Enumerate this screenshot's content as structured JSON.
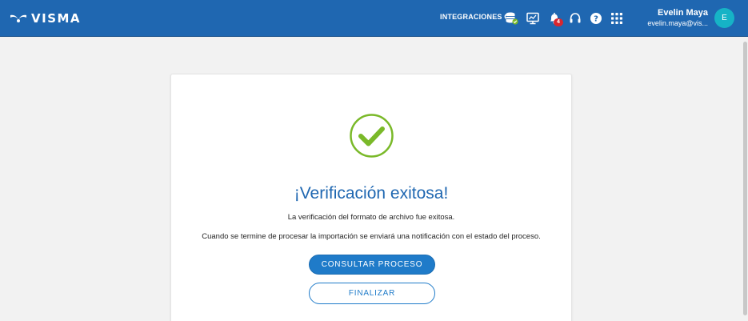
{
  "header": {
    "brand": "VISMA",
    "integrations_label": "INTEGRACIONES CS",
    "icons": [
      "database-check-icon",
      "monitor-chart-icon",
      "bell-icon",
      "headset-icon",
      "help-icon",
      "apps-grid-icon"
    ],
    "notification_count": "4",
    "user": {
      "name": "Evelin Maya",
      "email": "evelin.maya@vis...",
      "avatar_initial": "E"
    }
  },
  "main": {
    "status_icon": "success-check-icon",
    "title": "¡Verificación exitosa!",
    "message": "La verificación del formato de archivo fue exitosa.",
    "note": "Cuando se termine de procesar la importación se enviará una notificación con el estado del proceso.",
    "primary_button": "CONSULTAR PROCESO",
    "secondary_button": "FINALIZAR"
  },
  "colors": {
    "header_bg": "#1f67b1",
    "accent_blue": "#1f7bc9",
    "success_green": "#7ab929",
    "avatar_bg": "#16b3c6",
    "badge_red": "#d9262e",
    "page_bg": "#f2f2f2"
  }
}
